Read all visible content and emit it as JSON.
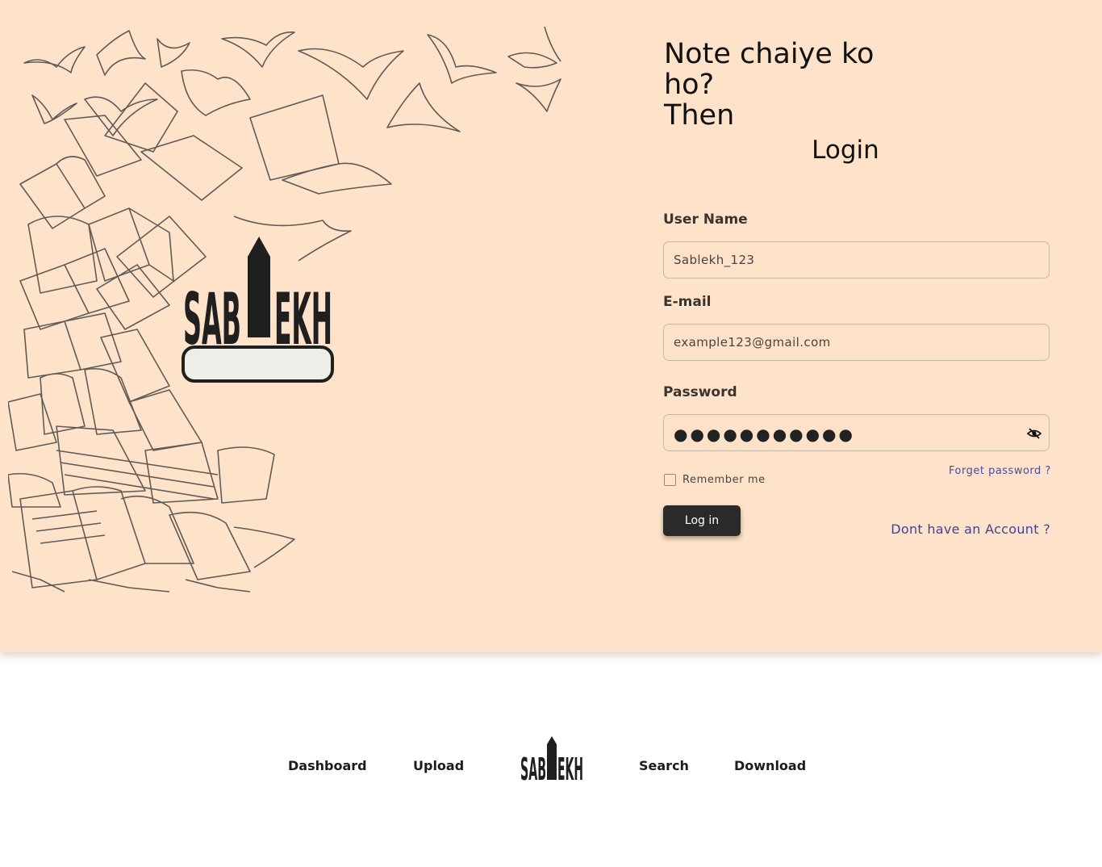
{
  "hero": {
    "headline_lines": [
      "Note chaiye ko",
      "ho?",
      "Then"
    ],
    "login_title": "Login",
    "logo_alt": "SABLEKH",
    "illustration_icon": "flying-books-illustration"
  },
  "form": {
    "username": {
      "label": "User Name",
      "value": "Sablekh_123"
    },
    "email": {
      "label": "E-mail",
      "value": "example123@gmail.com"
    },
    "password": {
      "label": "Password",
      "masked_value": "●●●●●●●●●●●",
      "toggle_icon": "eye-slash-icon"
    },
    "remember_label": "Remember me",
    "forget_link": "Forget password ?",
    "login_button": "Log in",
    "signup_link": "Dont have an Account ?"
  },
  "footer": {
    "links": [
      "Dashboard",
      "Upload",
      "Search",
      "Download"
    ],
    "logo_alt": "SABLEKH"
  },
  "colors": {
    "hero_bg": "#fee2c9",
    "button_bg": "#2a2a2a",
    "link": "#3f4593"
  }
}
